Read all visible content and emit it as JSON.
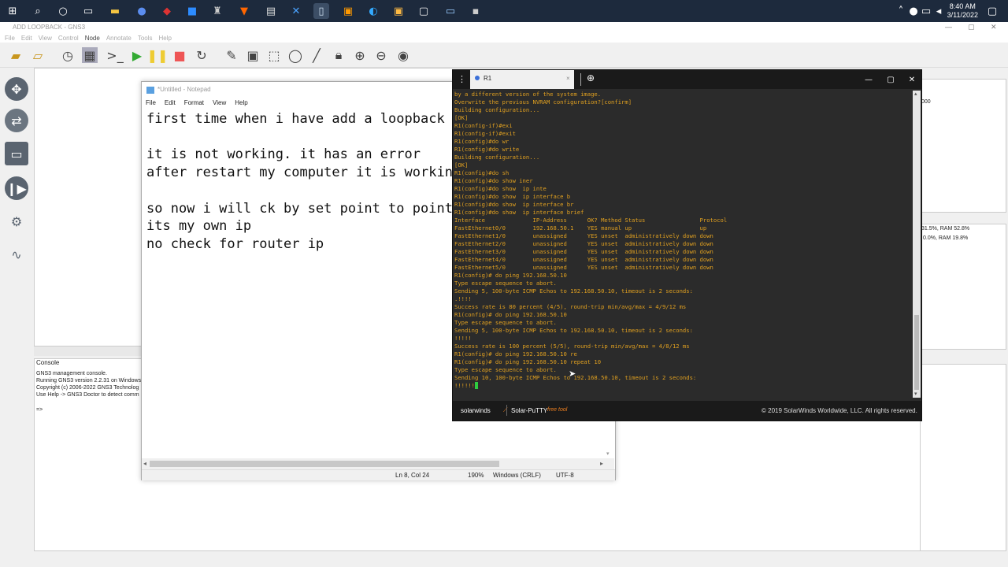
{
  "taskbar": {
    "time": "8:40 AM",
    "date": "3/11/2022"
  },
  "gns3": {
    "title": "ADD LOOPBACK - GNS3",
    "menu": [
      "File",
      "Edit",
      "View",
      "Control",
      "Node",
      "Annotate",
      "Tools",
      "Help"
    ],
    "console_title": "Console",
    "console_lines": [
      "GNS3 management console.",
      "Running GNS3 version 2.2.31 on Windows",
      "Copyright (c) 2006-2022 GNS3 Technolog",
      "Use Help -> GNS3 Doctor to detect comm",
      "",
      "=>"
    ],
    "right_panel": {
      "top_value": "000",
      "cpu_line_1": "31.5%, RAM 52.8%",
      "cpu_line_2": "0.0%, RAM 19.8%"
    }
  },
  "notepad": {
    "title": "*Untitled - Notepad",
    "menu": [
      "File",
      "Edit",
      "Format",
      "View",
      "Help"
    ],
    "lines": [
      "first time when i have add a loopback",
      "",
      "it is not working. it has an error",
      "after restart my computer it is working",
      "",
      "so now i will ck by set point to point",
      "its my own ip",
      "no check for router ip"
    ],
    "status": {
      "position": "Ln 8, Col 24",
      "zoom": "190%",
      "line_ending": "Windows (CRLF)",
      "encoding": "UTF-8"
    }
  },
  "putty": {
    "tab_label": "R1",
    "brand": "solarwinds",
    "product": "Solar-PuTTY",
    "product_tag": "free tool",
    "copyright": "© 2019 SolarWinds Worldwide, LLC. All rights reserved.",
    "terminal_lines": [
      "by a different version of the system image.",
      "Overwrite the previous NVRAM configuration?[confirm]",
      "Building configuration...",
      "[OK]",
      "R1(config-if)#exi",
      "R1(config-if)#exit",
      "R1(config)#do wr",
      "R1(config)#do write",
      "Building configuration...",
      "[OK]",
      "R1(config)#do sh",
      "R1(config)#do show iner",
      "R1(config)#do show  ip inte",
      "R1(config)#do show  ip interface b",
      "R1(config)#do show  ip interface br",
      "R1(config)#do show  ip interface brief",
      "Interface              IP-Address      OK? Method Status                Protocol",
      "FastEthernet0/0        192.168.50.1    YES manual up                    up",
      "FastEthernet1/0        unassigned      YES unset  administratively down down",
      "FastEthernet2/0        unassigned      YES unset  administratively down down",
      "FastEthernet3/0        unassigned      YES unset  administratively down down",
      "FastEthernet4/0        unassigned      YES unset  administratively down down",
      "FastEthernet5/0        unassigned      YES unset  administratively down down",
      "R1(config)# do ping 192.168.50.10",
      "Type escape sequence to abort.",
      "Sending 5, 100-byte ICMP Echos to 192.168.50.10, timeout is 2 seconds:",
      ".!!!!",
      "Success rate is 80 percent (4/5), round-trip min/avg/max = 4/9/12 ms",
      "R1(config)# do ping 192.168.50.10",
      "Type escape sequence to abort.",
      "Sending 5, 100-byte ICMP Echos to 192.168.50.10, timeout is 2 seconds:",
      "!!!!!",
      "Success rate is 100 percent (5/5), round-trip min/avg/max = 4/8/12 ms",
      "R1(config)# do ping 192.168.50.10 re",
      "R1(config)# do ping 192.168.50.10 repeat 10",
      "Type escape sequence to abort.",
      "Sending 10, 100-byte ICMP Echos to 192.168.50.10, timeout is 2 seconds:",
      "!!!!!!"
    ]
  }
}
